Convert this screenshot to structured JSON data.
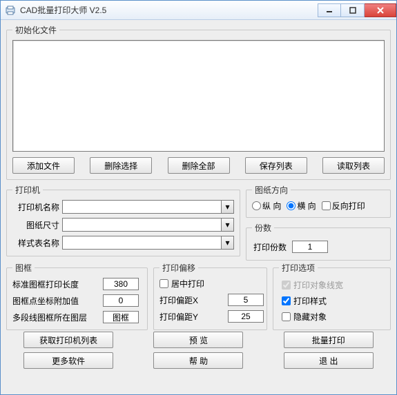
{
  "window": {
    "title": "CAD批量打印大师 V2.5"
  },
  "init_group": {
    "legend": "初始化文件",
    "buttons": {
      "add_file": "添加文件",
      "remove_sel": "删除选择",
      "remove_all": "删除全部",
      "save_list": "保存列表",
      "load_list": "读取列表"
    }
  },
  "printer_group": {
    "legend": "打印机",
    "labels": {
      "name": "打印机名称",
      "paper": "图纸尺寸",
      "style": "样式表名称"
    },
    "values": {
      "name": "",
      "paper": "",
      "style": ""
    }
  },
  "orient_group": {
    "legend": "图纸方向",
    "options": {
      "portrait": "纵 向",
      "landscape": "横 向",
      "reverse": "反向打印"
    },
    "selected": "landscape"
  },
  "copies_group": {
    "legend": "份数",
    "label": "打印份数",
    "value": "1"
  },
  "frame_group": {
    "legend": "图框",
    "labels": {
      "std_len": "标准图框打印长度",
      "attach": "图框点坐标附加值",
      "layer": "多段线图框所在图层"
    },
    "values": {
      "std_len": "380",
      "attach": "0",
      "layer": "图框"
    }
  },
  "offset_group": {
    "legend": "打印偏移",
    "center_label": "居中打印",
    "labels": {
      "x": "打印偏距X",
      "y": "打印偏距Y"
    },
    "values": {
      "x": "5",
      "y": "25"
    }
  },
  "options_group": {
    "legend": "打印选项",
    "labels": {
      "lineweight": "打印对象线宽",
      "style": "打印样式",
      "hide": "隐藏对象"
    },
    "checked": {
      "lineweight": true,
      "style": true,
      "hide": false
    },
    "enabled": {
      "lineweight": false,
      "style": true,
      "hide": true
    }
  },
  "bottom_buttons": {
    "get_printers": "获取打印机列表",
    "more_soft": "更多软件",
    "preview": "预 览",
    "help": "帮 助",
    "batch_print": "批量打印",
    "exit": "退 出"
  }
}
